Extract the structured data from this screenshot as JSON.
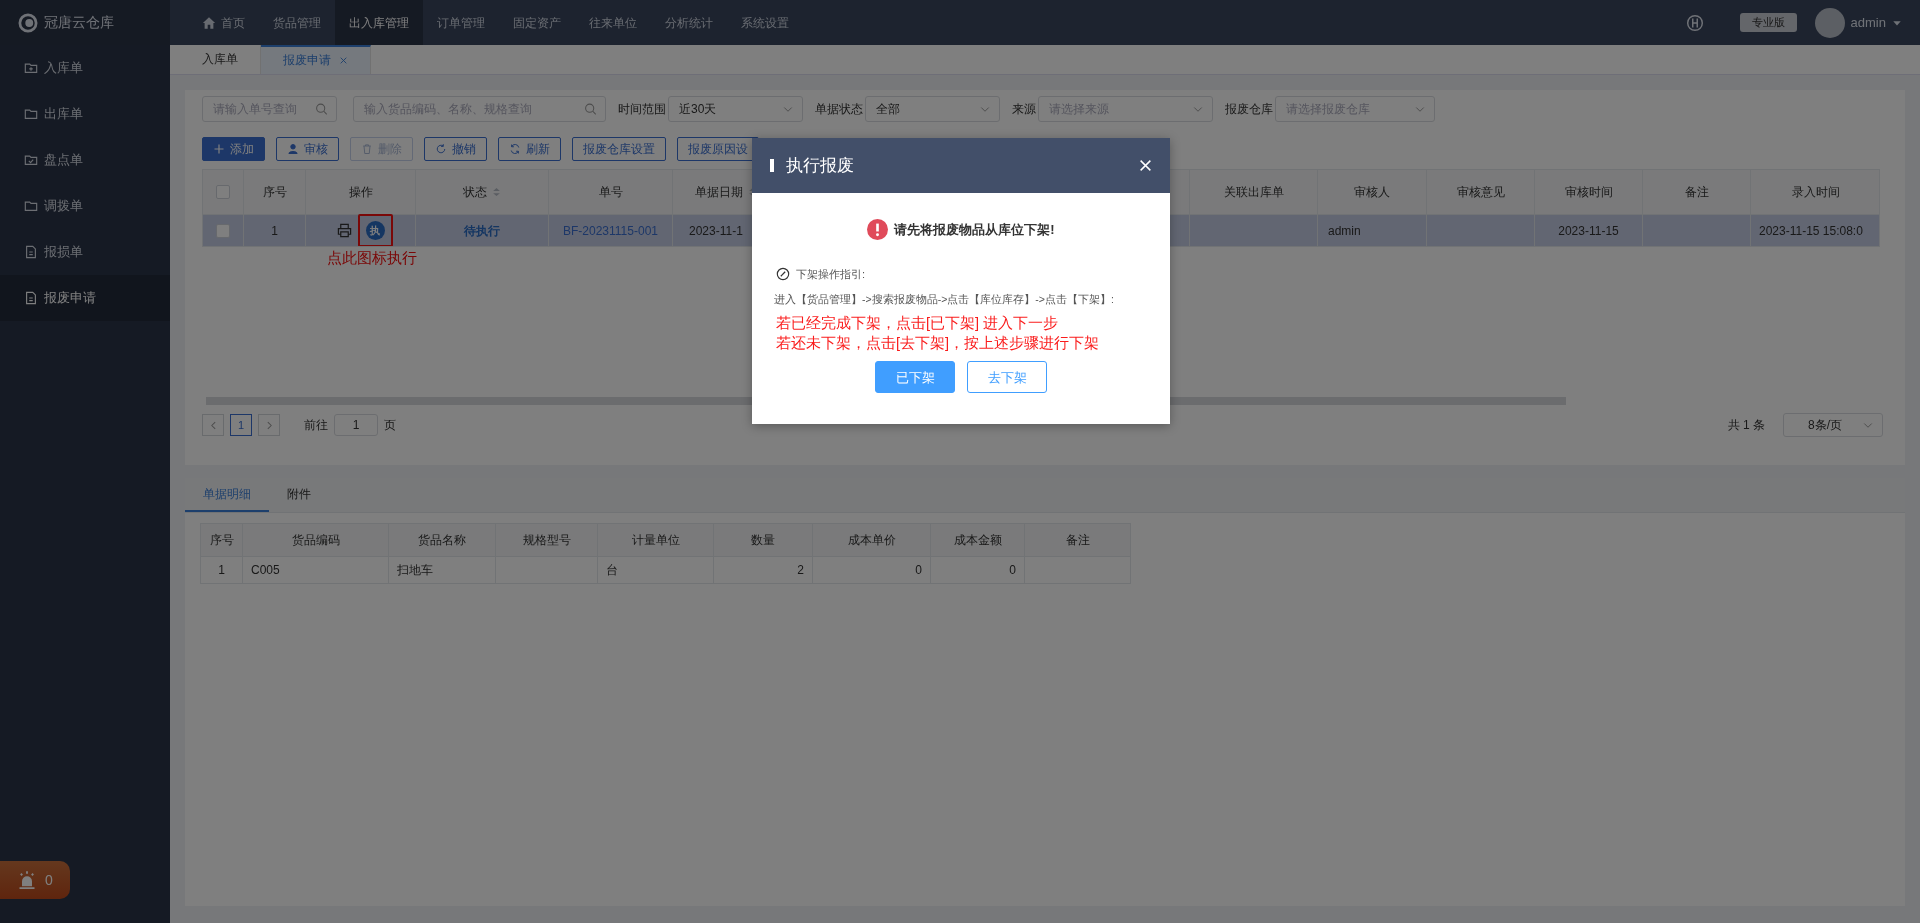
{
  "app": {
    "logo": "冠唐云仓库",
    "nav": [
      {
        "label": "首页",
        "selected": false
      },
      {
        "label": "货品管理",
        "selected": false
      },
      {
        "label": "出入库管理",
        "selected": true
      },
      {
        "label": "订单管理",
        "selected": false
      },
      {
        "label": "固定资产",
        "selected": false
      },
      {
        "label": "往来单位",
        "selected": false
      },
      {
        "label": "分析统计",
        "selected": false
      },
      {
        "label": "系统设置",
        "selected": false
      }
    ],
    "edition": "专业版",
    "user": "admin"
  },
  "sidebar": {
    "items": [
      {
        "label": "入库单",
        "selected": false
      },
      {
        "label": "出库单",
        "selected": false
      },
      {
        "label": "盘点单",
        "selected": false
      },
      {
        "label": "调拨单",
        "selected": false
      },
      {
        "label": "报损单",
        "selected": false
      },
      {
        "label": "报废申请",
        "selected": true
      }
    ],
    "alarm_count": "0"
  },
  "tabs": [
    {
      "label": "入库单",
      "selected": false,
      "closable": false
    },
    {
      "label": "报废申请",
      "selected": true,
      "closable": true
    }
  ],
  "filters": {
    "order_search": {
      "placeholder": "请输入单号查询"
    },
    "goods_search": {
      "placeholder": "输入货品编码、名称、规格查询"
    },
    "selects": [
      {
        "label": "时间范围",
        "value": "近30天"
      },
      {
        "label": "单据状态",
        "value": "全部"
      },
      {
        "label": "来源",
        "placeholder": "请选择来源"
      },
      {
        "label": "报废仓库",
        "placeholder": "请选择报废仓库"
      }
    ]
  },
  "toolbar": [
    {
      "label": "添加",
      "kind": "primary",
      "disabled": false
    },
    {
      "label": "审核",
      "kind": "outline",
      "disabled": false
    },
    {
      "label": "删除",
      "kind": "outline",
      "disabled": true
    },
    {
      "label": "撤销",
      "kind": "outline",
      "disabled": false
    },
    {
      "label": "刷新",
      "kind": "outline",
      "disabled": false
    },
    {
      "label": "报废仓库设置",
      "kind": "outline",
      "disabled": false
    },
    {
      "label": "报废原因设",
      "kind": "outline",
      "disabled": false
    }
  ],
  "table": {
    "all_checked": false,
    "columns": [
      {
        "label": "序号",
        "sortable": false
      },
      {
        "label": "操作",
        "sortable": false
      },
      {
        "label": "状态",
        "sortable": true
      },
      {
        "label": "单号",
        "sortable": false
      },
      {
        "label": "单据日期",
        "sortable": true
      },
      {
        "label": "关联出库单",
        "sortable": false
      },
      {
        "label": "审核人",
        "sortable": false
      },
      {
        "label": "审核意见",
        "sortable": false
      },
      {
        "label": "审核时间",
        "sortable": false
      },
      {
        "label": "备注",
        "sortable": false
      },
      {
        "label": "录入时间",
        "sortable": false
      }
    ],
    "rows": [
      {
        "selected": true,
        "checked": false,
        "index": "1",
        "action": "执",
        "status": "待执行",
        "number": "BF-20231115-001",
        "date": "2023-11-1",
        "auditor": "admin",
        "audit_time": "2023-11-15",
        "entry_time": "2023-11-15 15:08:0"
      }
    ]
  },
  "annotation": "点此图标执行",
  "pagination": {
    "page": "1",
    "goto_label": "前往",
    "goto_value": "1",
    "page_suffix": "页",
    "total": "共 1 条",
    "page_size": "8条/页"
  },
  "detail": {
    "tabs": [
      {
        "label": "单据明细",
        "selected": true
      },
      {
        "label": "附件",
        "selected": false
      }
    ],
    "columns": [
      "序号",
      "货品编码",
      "货品名称",
      "规格型号",
      "计量单位",
      "数量",
      "成本单价",
      "成本金额",
      "备注"
    ],
    "rows": [
      [
        "1",
        "C005",
        "扫地车",
        "",
        "台",
        "2",
        "0",
        "0",
        ""
      ]
    ]
  },
  "dialog": {
    "title": "执行报废",
    "message": "请先将报废物品从库位下架!",
    "guide_title": "下架操作指引:",
    "guide": "进入【货品管理】->搜索报废物品->点击【库位库存】->点击【下架】:",
    "notes": [
      "若已经完成下架，点击[已下架] 进入下一步",
      "若还未下架，点击[去下架]，按上述步骤进行下架"
    ],
    "buttons": [
      {
        "label": "已下架",
        "kind": "primary"
      },
      {
        "label": "去下架",
        "kind": "outline"
      }
    ]
  }
}
